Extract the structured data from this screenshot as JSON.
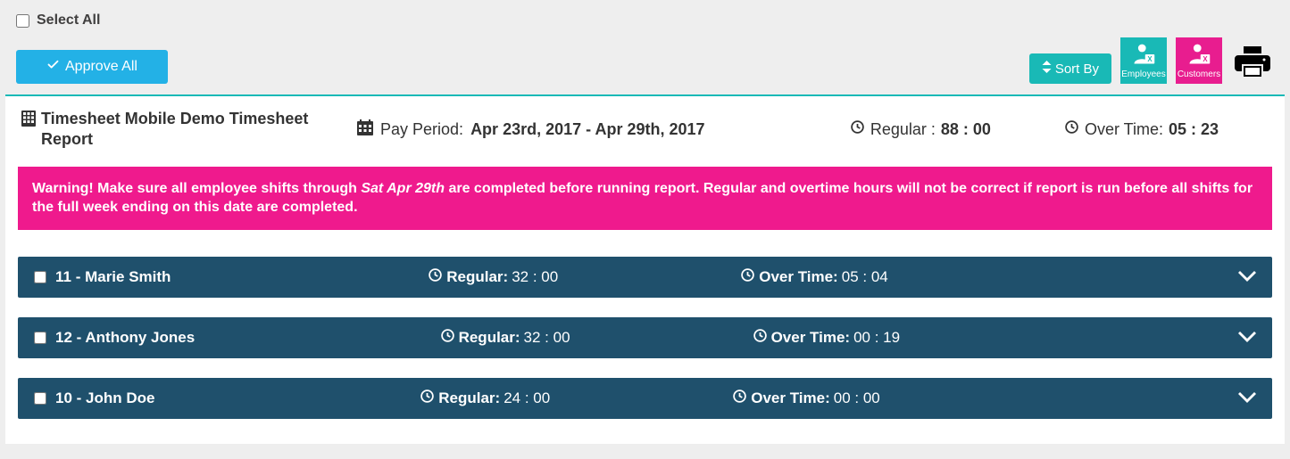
{
  "select_all_label": "Select All",
  "approve_all_label": "Approve All",
  "sort_by_label": "Sort By",
  "export_employees_label": "Employees",
  "export_customers_label": "Customers",
  "report_title": "Timesheet Mobile Demo Timesheet Report",
  "pay_period_label": "Pay Period:",
  "pay_period_value": "Apr 23rd, 2017 - Apr 29th, 2017",
  "summary_regular_label": "Regular :",
  "summary_regular_value": "88 : 00",
  "summary_overtime_label": "Over Time:",
  "summary_overtime_value": "05 : 23",
  "warning": {
    "prefix": "Warning! Make sure all employee shifts through ",
    "emphasis": "Sat Apr 29th",
    "suffix": " are completed before running report. Regular and overtime hours will not be correct if report is run before all shifts for the full week ending on this date are completed."
  },
  "row_labels": {
    "regular": "Regular:",
    "overtime": "Over Time:"
  },
  "employees": [
    {
      "name": "11 - Marie Smith",
      "regular": "32 : 00",
      "overtime": "05 : 04"
    },
    {
      "name": "12 - Anthony Jones",
      "regular": "32 : 00",
      "overtime": "00 : 19"
    },
    {
      "name": "10 - John Doe",
      "regular": "24 : 00",
      "overtime": "00 : 00"
    }
  ]
}
